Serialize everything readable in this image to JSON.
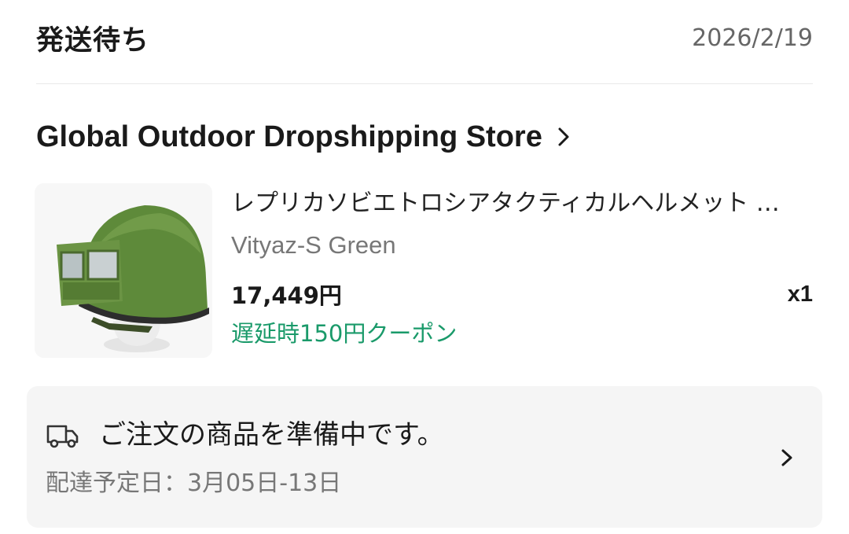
{
  "order": {
    "status": "発送待ち",
    "date": "2026/2/19"
  },
  "store": {
    "name": "Global Outdoor Dropshipping Store"
  },
  "product": {
    "title": "レプリカソビエトロシアタクティカルヘルメット …",
    "variant": "Vityaz-S Green",
    "price": "17,449円",
    "quantity": "x1",
    "coupon": "遅延時150円クーポン",
    "image_icon": "helmet-product-image"
  },
  "shipping": {
    "status": "ご注文の商品を準備中です。",
    "estimate": "配達予定日：3月05日-13日",
    "icon": "truck-icon"
  },
  "colors": {
    "coupon_green": "#1a9a6a",
    "muted_text": "#777777",
    "box_bg": "#f5f5f5"
  }
}
